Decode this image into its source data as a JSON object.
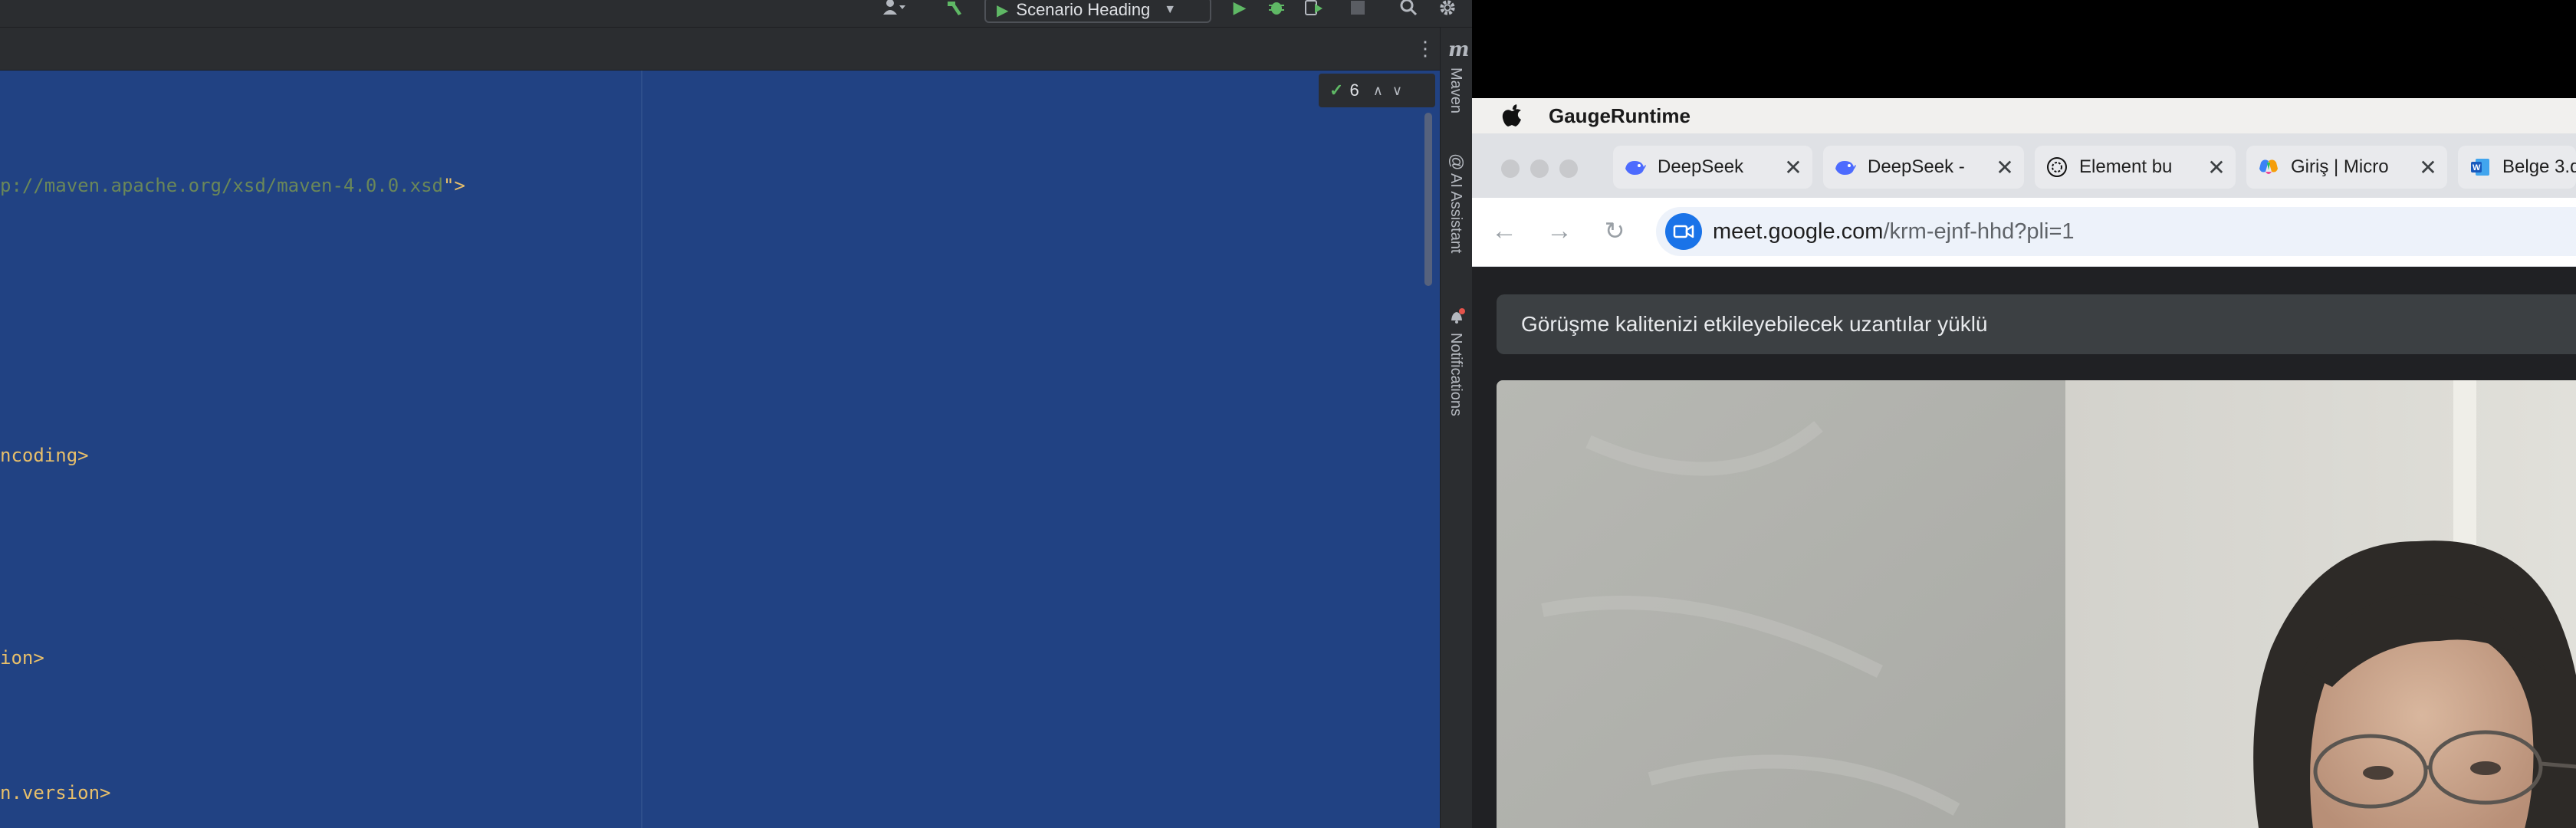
{
  "ide": {
    "run_config_label": "Scenario Heading",
    "inspection_count": "6",
    "code_lines": [
      {
        "url": "p://maven.apache.org/xsd/maven-4.0.0.xsd",
        "suffix": "\">"
      },
      {
        "text": "ncoding>"
      },
      {
        "text": "ion>"
      },
      {
        "text": "n.version>"
      }
    ],
    "side_tools": {
      "maven": "Maven",
      "ai_assistant": "AI Assistant",
      "notifications": "Notifications"
    }
  },
  "mac": {
    "app_name": "GaugeRuntime"
  },
  "browser": {
    "tabs": [
      {
        "title": "DeepSeek",
        "icon": "deepseek-whale-icon",
        "active": false
      },
      {
        "title": "DeepSeek -",
        "icon": "deepseek-whale-icon",
        "active": false
      },
      {
        "title": "Element bu",
        "icon": "chatgpt-icon",
        "active": false
      },
      {
        "title": "Giriş | Micro",
        "icon": "microsoft-copilot-icon",
        "active": false
      },
      {
        "title": "Belge 3.d",
        "icon": "word-icon",
        "active": false
      }
    ],
    "url_domain": "meet.google.com",
    "url_path": "/krm-ejnf-hhd?pli=1"
  },
  "meet": {
    "banner_text": "Görüşme kalitenizi etkileyebilecek uzantılar yüklü"
  }
}
